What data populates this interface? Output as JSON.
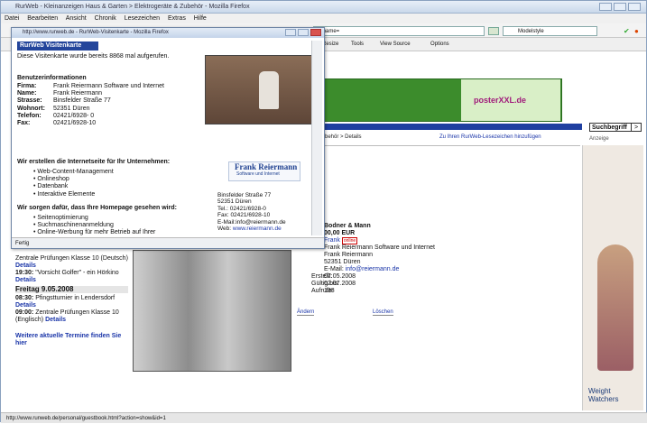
{
  "browser": {
    "title": "RurWeb - Kleinanzeigen Haus & Garten > Elektrogeräte & Zubehör - Mozilla Firefox",
    "menu": [
      "Datei",
      "Bearbeiten",
      "Ansicht",
      "Chronik",
      "Lesezeichen",
      "Extras",
      "Hilfe"
    ],
    "url_fragment": "38name=",
    "search_value": "Modelstyle",
    "toolbar_items": [
      "Resize",
      "Tools",
      "View Source",
      "Options"
    ],
    "status": "http://www.runweb.de/personal/guestbook.html?action=show&id=1"
  },
  "main": {
    "banner_brand": "posterXXL.de",
    "search_label": "Suchbegriff",
    "search_button": ">",
    "breadcrumb": "Zubehör > Details",
    "bookmark_link": "Zu Ihren RurWeb-Lesezeichen hinzufügen",
    "ad_label": "Anzeige",
    "ad_brand": "Weight Watchers",
    "item_title": "Bodner & Mann",
    "price": "00,00 EUR",
    "seller_name": "Frank",
    "seller_badge": "online",
    "seller_lines": [
      "Frank Reiermann Software und Internet",
      "Frank Reiermann",
      "52351 Düren",
      "E-Mail: "
    ],
    "email": "info@reiermann.de",
    "meta": [
      {
        "label": "Erstellt:",
        "value": "07.05.2008"
      },
      {
        "label": "Gültig bis:",
        "value": "02.07.2008"
      },
      {
        "label": "Aufrufe:",
        "value": "138"
      }
    ],
    "btn_change": "Ändern",
    "btn_delete": "Löschen",
    "events": [
      {
        "time": "",
        "text": "Zentrale Prüfungen Klasse 10 (Deutsch)",
        "link": "Details"
      },
      {
        "time": "19:30:",
        "text": "\"Vorsicht Golfer\" - ein Hörkino",
        "link": "Details"
      }
    ],
    "date_header": "Freitag 9.05.2008",
    "events2": [
      {
        "time": "08:30:",
        "text": "Pfingstturnier in Lendersdorf",
        "link": "Details"
      },
      {
        "time": "09:00:",
        "text": "Zentrale Prüfungen Klasse 10 (Englisch)",
        "link": "Details"
      }
    ],
    "more_events": "Weitere aktuelle Termine finden Sie hier"
  },
  "popup": {
    "title": "http://www.runweb.de - RurWeb-Visitenkarte - Mozilla Firefox",
    "header": "RurWeb Visitenkarte",
    "views": "Diese Visitenkarte wurde bereits 8868 mal aufgerufen.",
    "info_heading": "Benutzerinformationen",
    "info": [
      {
        "label": "Firma:",
        "value": "Frank Reiermann Software und Internet"
      },
      {
        "label": "Name:",
        "value": "Frank Reiermann"
      },
      {
        "label": "Strasse:",
        "value": "Binsfelder Straße 77"
      },
      {
        "label": "Wohnort:",
        "value": "52351 Düren"
      },
      {
        "label": "Telefon:",
        "value": "02421/6928- 0"
      },
      {
        "label": "Fax:",
        "value": "02421/6928-10"
      }
    ],
    "section1": "Wir erstellen die Internetseite für Ihr Unternehmen:",
    "list1": [
      "Web-Content-Management",
      "Onlineshop",
      "Datenbank",
      "Interaktive Elemente"
    ],
    "section2": "Wir sorgen dafür, dass Ihre Homepage gesehen wird:",
    "list2": [
      "Seitenoptimierung",
      "Suchmaschinenanmeldung",
      "Online-Werbung für mehr Betrieb auf Ihrer"
    ],
    "logo_line1": "Frank Reiermann",
    "logo_line2": "Software und Internet",
    "address": [
      "Binsfelder Straße 77",
      "52351 Düren",
      "Tel.:    02421/6928-0",
      "Fax:    02421/6928-10",
      "E-Mail:info@reiermann.de"
    ],
    "web_label": "Web:",
    "web_value": "www.reiermann.de",
    "status": "Fertig"
  }
}
